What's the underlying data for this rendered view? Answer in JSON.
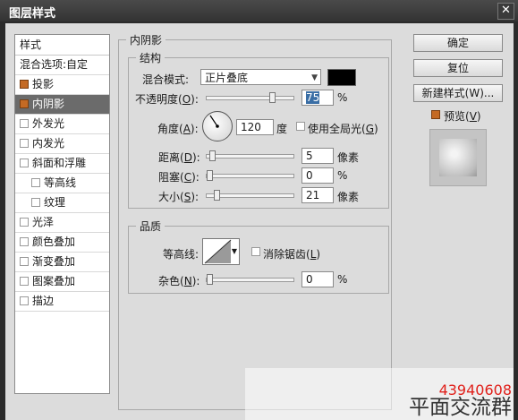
{
  "window": {
    "title": "图层样式",
    "close_glyph": "✕"
  },
  "left_panel": {
    "header": "样式",
    "blend_options": "混合选项:自定",
    "items": [
      {
        "label": "投影",
        "checked": true,
        "sub": false,
        "selected": false
      },
      {
        "label": "内阴影",
        "checked": true,
        "sub": false,
        "selected": true
      },
      {
        "label": "外发光",
        "checked": false,
        "sub": false,
        "selected": false
      },
      {
        "label": "内发光",
        "checked": false,
        "sub": false,
        "selected": false
      },
      {
        "label": "斜面和浮雕",
        "checked": false,
        "sub": false,
        "selected": false
      },
      {
        "label": "等高线",
        "checked": false,
        "sub": true,
        "selected": false
      },
      {
        "label": "纹理",
        "checked": false,
        "sub": true,
        "selected": false
      },
      {
        "label": "光泽",
        "checked": false,
        "sub": false,
        "selected": false
      },
      {
        "label": "颜色叠加",
        "checked": false,
        "sub": false,
        "selected": false
      },
      {
        "label": "渐变叠加",
        "checked": false,
        "sub": false,
        "selected": false
      },
      {
        "label": "图案叠加",
        "checked": false,
        "sub": false,
        "selected": false
      },
      {
        "label": "描边",
        "checked": false,
        "sub": false,
        "selected": false
      }
    ]
  },
  "inner_shadow": {
    "group_title": "内阴影",
    "structure": {
      "title": "结构",
      "blend_mode_label": "混合模式:",
      "blend_mode_value": "正片叠底",
      "shadow_color": "#000000",
      "opacity_label": "不透明度",
      "opacity_key": "O",
      "opacity_value": "75",
      "opacity_level": 0.75,
      "percent": "%",
      "angle_label": "角度",
      "angle_key": "A",
      "angle_value": "120",
      "degree": "度",
      "global_light_label": "使用全局光",
      "global_light_key": "G",
      "global_light_checked": false,
      "distance_label": "距离",
      "distance_key": "D",
      "distance_value": "5",
      "distance_unit": "像素",
      "choke_label": "阻塞",
      "choke_key": "C",
      "choke_value": "0",
      "size_label": "大小",
      "size_key": "S",
      "size_value": "21",
      "size_unit": "像素"
    },
    "quality": {
      "title": "品质",
      "contour_label": "等高线:",
      "anti_alias_label": "消除锯齿",
      "anti_alias_key": "L",
      "anti_alias_checked": false,
      "noise_label": "杂色",
      "noise_key": "N",
      "noise_value": "0",
      "percent": "%"
    }
  },
  "buttons": {
    "ok": "确定",
    "reset": "复位",
    "new_style": "新建样式(W)...",
    "preview_label": "预览",
    "preview_key": "V",
    "preview_checked": true
  },
  "watermark": {
    "number": "43940608",
    "text": "平面交流群"
  },
  "colors": {
    "accent_checkbox": "#c46a24",
    "selection": "#6b6b6b"
  }
}
